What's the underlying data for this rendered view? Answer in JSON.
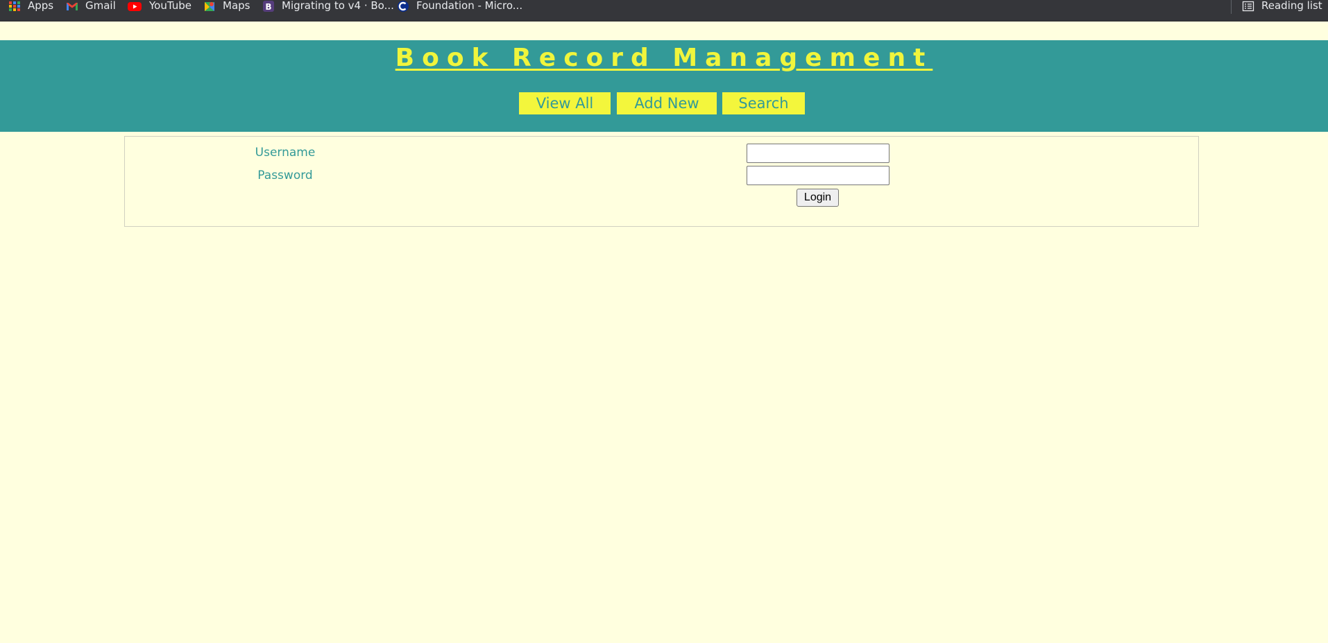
{
  "bookmarks_bar": {
    "items": [
      {
        "label": "Apps",
        "icon": "apps-grid-icon"
      },
      {
        "label": "Gmail",
        "icon": "gmail-icon"
      },
      {
        "label": "YouTube",
        "icon": "youtube-icon"
      },
      {
        "label": "Maps",
        "icon": "maps-icon"
      },
      {
        "label": "Migrating to v4 · Bo...",
        "icon": "bootstrap-icon"
      },
      {
        "label": "Foundation - Micro...",
        "icon": "foundation-icon"
      }
    ],
    "reading_list": {
      "label": "Reading list",
      "icon": "reading-list-icon"
    }
  },
  "header": {
    "title": "Book Record Management",
    "nav": [
      {
        "label": "View All"
      },
      {
        "label": "Add New"
      },
      {
        "label": "Search"
      }
    ]
  },
  "login": {
    "username_label": "Username",
    "password_label": "Password",
    "username_value": "",
    "password_value": "",
    "submit_label": "Login"
  },
  "colors": {
    "page_background": "#ffffdf",
    "header_background": "#339a98",
    "title_color": "#f0f53c",
    "nav_button_background": "#f3f63c",
    "nav_text": "#339a98",
    "label_text": "#339a98",
    "browser_bar": "#35363a"
  }
}
